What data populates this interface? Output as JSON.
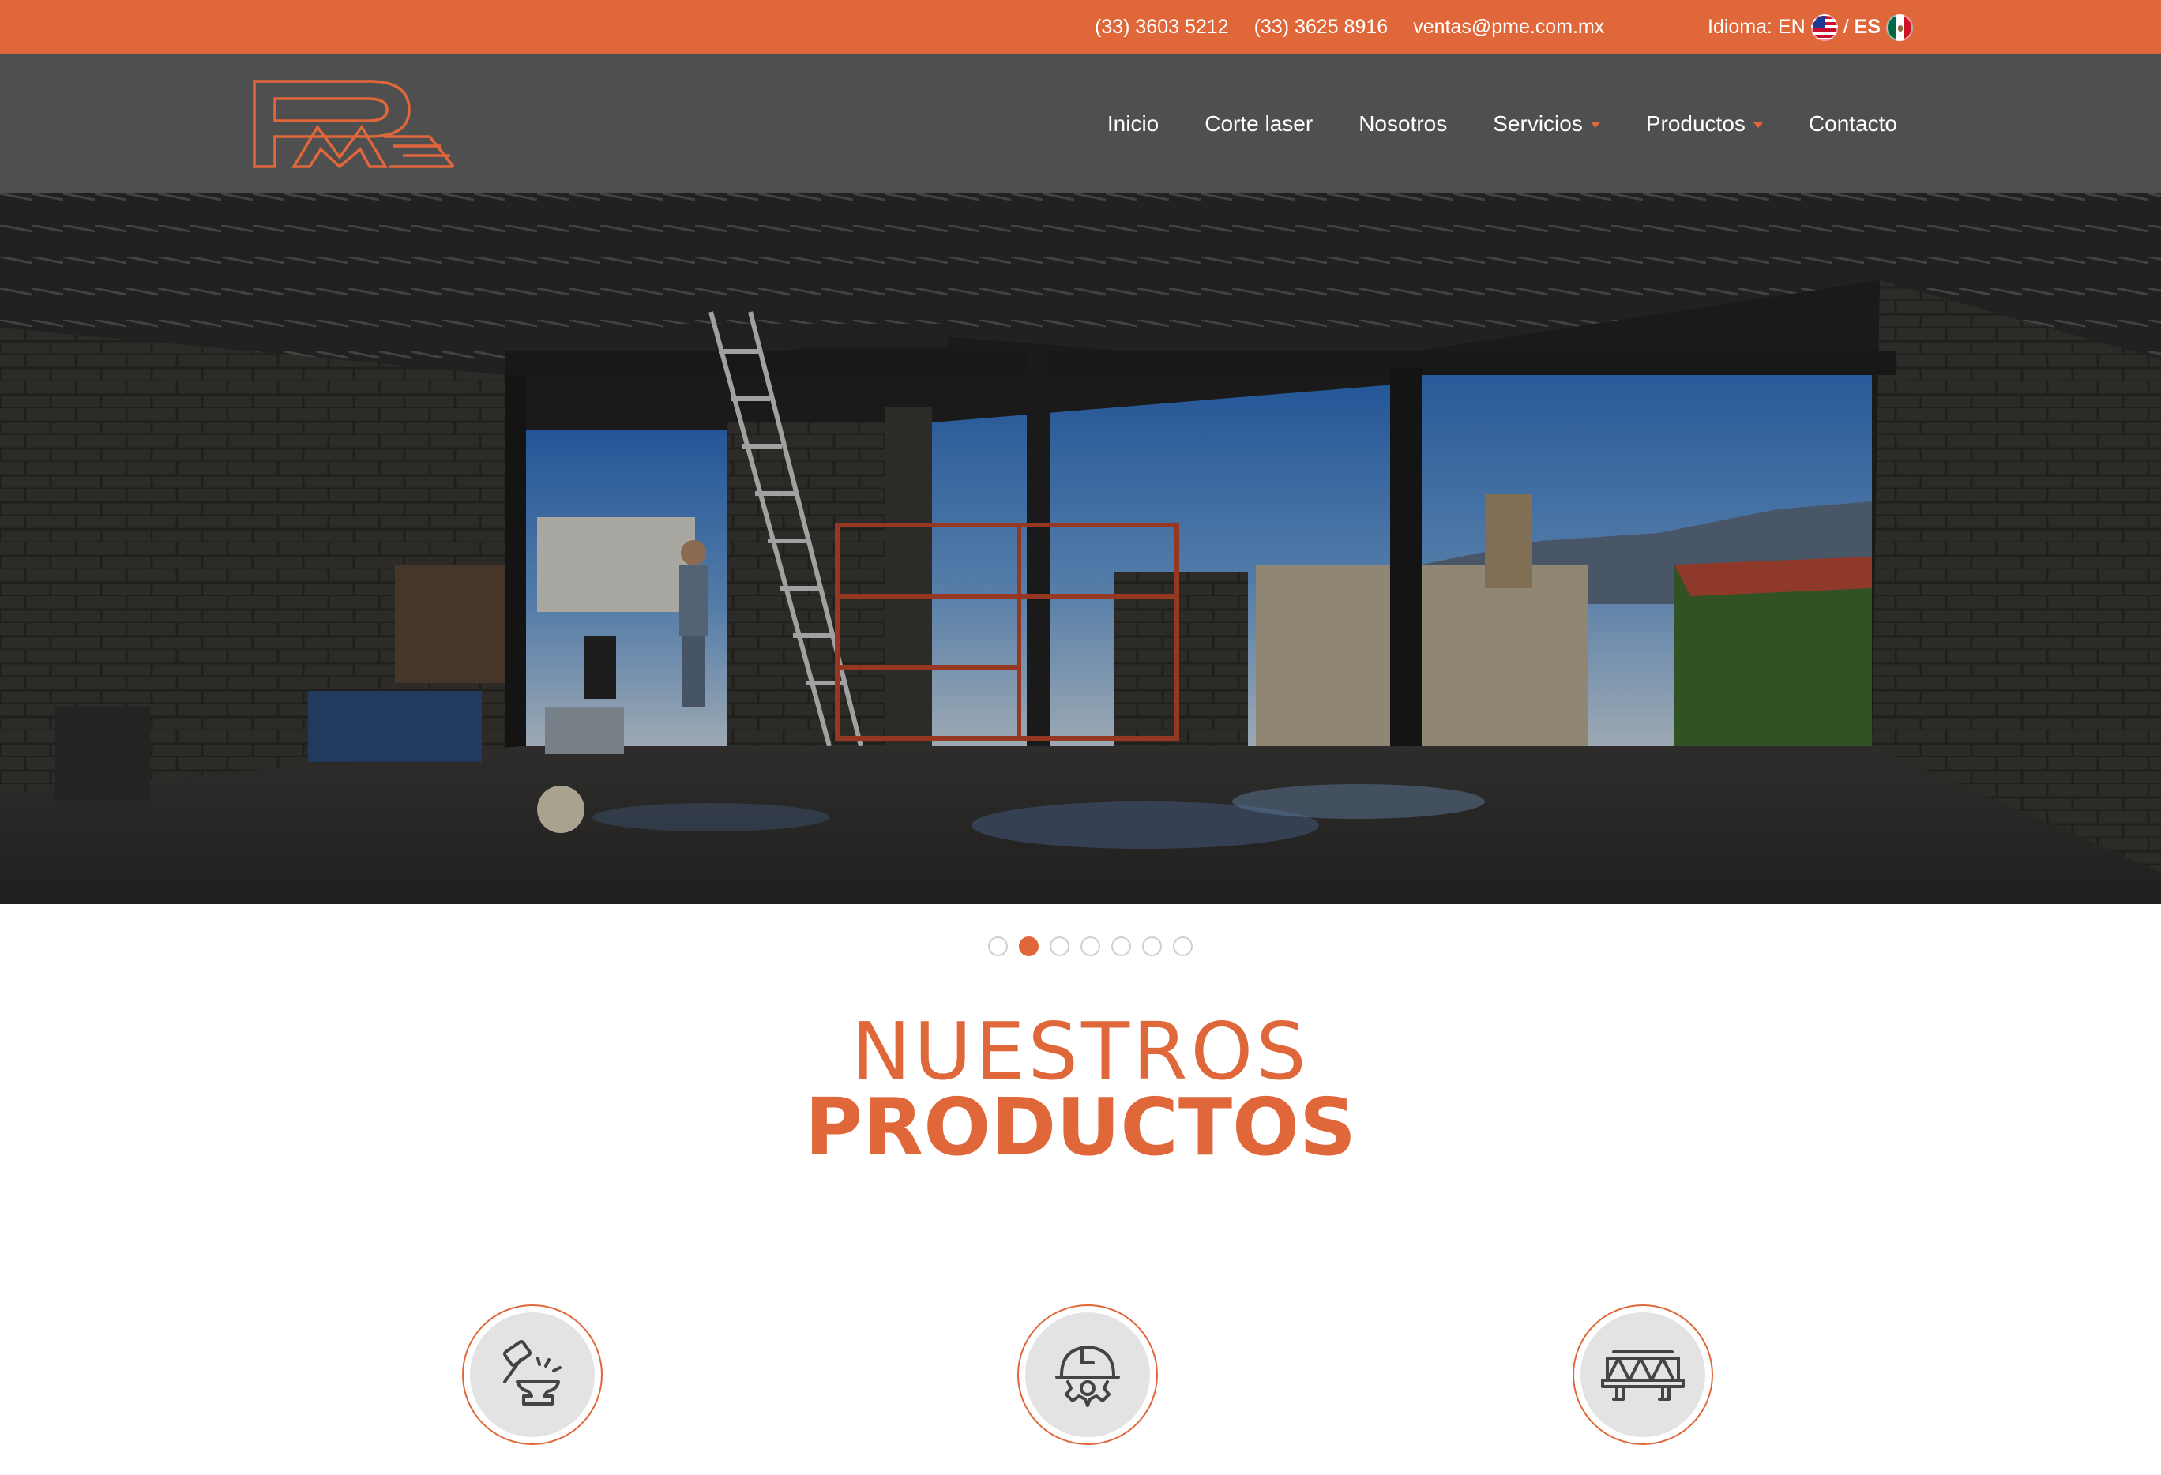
{
  "topbar": {
    "phone1": "(33) 3603 5212",
    "phone2": "(33) 3625 8916",
    "email": "ventas@pme.com.mx",
    "lang_label": "Idioma:",
    "lang_en": "EN",
    "lang_sep": "/",
    "lang_es": "ES"
  },
  "logo": {
    "text": "PME"
  },
  "nav": {
    "items": [
      {
        "label": "Inicio"
      },
      {
        "label": "Corte laser"
      },
      {
        "label": "Nosotros"
      },
      {
        "label": "Servicios",
        "dropdown": true
      },
      {
        "label": "Productos",
        "dropdown": true
      },
      {
        "label": "Contacto"
      }
    ]
  },
  "slider": {
    "dot_count": 7,
    "active_index": 1
  },
  "section": {
    "title_line1": "NUESTROS",
    "title_line2": "PRODUCTOS"
  },
  "products": [
    {
      "icon": "anvil-hammer-icon"
    },
    {
      "icon": "hardhat-gear-icon"
    },
    {
      "icon": "truss-bridge-icon"
    }
  ],
  "colors": {
    "accent": "#e0673a",
    "nav_bg": "#4f4f4f",
    "icon_bg": "#e3e3e3"
  }
}
